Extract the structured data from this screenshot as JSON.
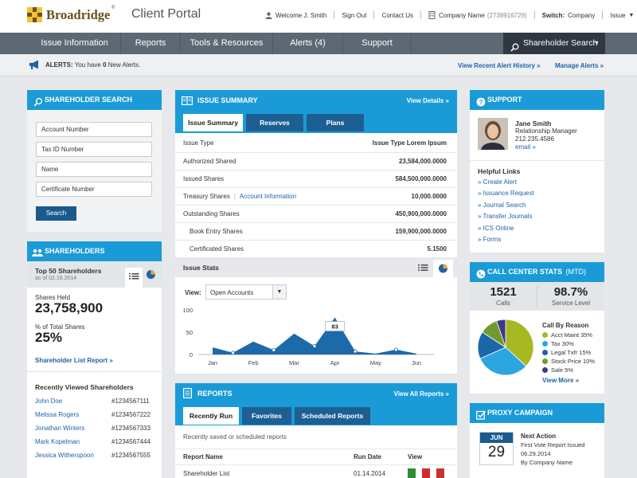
{
  "header": {
    "brand": "Broadridge",
    "trademark": "®",
    "portal_title": "Client Portal",
    "welcome_text": "Welcome J. Smith",
    "signout": "Sign Out",
    "contact": "Contact Us",
    "company": "Company Name",
    "company_id": "(2738916729)",
    "switch_label": "Switch:",
    "switch_company": "Company",
    "switch_issue": "Issue"
  },
  "nav": {
    "items": [
      "Issue Information",
      "Reports",
      "Tools & Resources",
      "Alerts (4)",
      "Support"
    ],
    "search_label": "Shareholder Search"
  },
  "alerts": {
    "prefix": "ALERTS:",
    "text_a": "You have",
    "count": "0",
    "text_b": "New Alerts.",
    "history_link": "View Recent Alert History »",
    "manage_link": "Manage Alerts »"
  },
  "shareholder_search": {
    "title": "SHAREHOLDER SEARCH",
    "fields": [
      "Account Number",
      "Tax ID Number",
      "Name",
      "Certificate Number"
    ],
    "button": "Search"
  },
  "shareholders": {
    "title": "SHAREHOLDERS",
    "top50_title": "Top 50 Shareholders",
    "top50_date": "as of 02.16.2014",
    "shares_held_label": "Shares Held",
    "shares_held": "23,758,900",
    "pct_label": "% of Total Shares",
    "pct": "25%",
    "report_link": "Shareholder List Report »",
    "recent_title": "Recently Viewed Shareholders",
    "recent": [
      {
        "name": "John Doe",
        "id": "#1234567111"
      },
      {
        "name": "Melissa Rogers",
        "id": "#1234567222"
      },
      {
        "name": "Jonathan Winters",
        "id": "#1234567333"
      },
      {
        "name": "Mark Kopelman",
        "id": "#1234567444"
      },
      {
        "name": "Jessica Witherspoon",
        "id": "#1234567555"
      }
    ]
  },
  "issue_summary": {
    "title": "ISSUE SUMMARY",
    "view_details": "View Details »",
    "tabs": [
      "Issue Summary",
      "Reserves",
      "Plans"
    ],
    "rows": [
      {
        "label": "Issue Type",
        "value": "Issue Type Lorem Ipsum"
      },
      {
        "label": "Authorized Shared",
        "value": "23,584,000.0000"
      },
      {
        "label": "Issued Shares",
        "value": "584,500,000.0000"
      },
      {
        "label": "Treasury Shares",
        "link": "Account Information",
        "value": "10,000.0000"
      },
      {
        "label": "Outstanding Shares",
        "value": "450,900,000.0000"
      },
      {
        "label": "Book Entry Shares",
        "value": "159,900,000.0000"
      },
      {
        "label": "Certificated Shares",
        "value": "5.1500"
      }
    ],
    "stats_title": "Issue Stats",
    "view_label": "View:",
    "view_selected": "Open Accounts"
  },
  "chart_data": {
    "type": "area",
    "categories": [
      "Jan",
      "Feb",
      "Mar",
      "Apr",
      "May",
      "Jun"
    ],
    "x": [
      0,
      0.5,
      1,
      1.5,
      2,
      2.5,
      3,
      3.5,
      4,
      4.5,
      5
    ],
    "values": [
      16,
      4,
      29,
      10,
      47,
      19,
      83,
      7,
      2,
      11,
      2
    ],
    "highlight_index": 6,
    "highlight_label": "83",
    "y_ticks": [
      0,
      50,
      100
    ],
    "ylim": [
      0,
      100
    ]
  },
  "reports": {
    "title": "REPORTS",
    "view_all": "View All Reports »",
    "tabs": [
      "Recently Run",
      "Favorites",
      "Scheduled Reports"
    ],
    "subtitle": "Recently saved or scheduled reports",
    "columns": [
      "Report Name",
      "Run Date",
      "View"
    ],
    "rows": [
      {
        "name": "Shareholder List",
        "date": "01.14.2014"
      }
    ]
  },
  "support": {
    "title": "SUPPORT",
    "name": "Jane Smith",
    "role": "Relationship Manager",
    "phone": "212.235.4586",
    "email": "email »",
    "links_title": "Helpful Links",
    "links": [
      "» Create Alert",
      "» Issuance Request",
      "» Journal Search",
      "» Transfer Journals",
      "» ICS Online",
      "» Forms"
    ]
  },
  "call_center": {
    "title": "CALL CENTER STATS",
    "title_suffix": "(MTD)",
    "calls": "1521",
    "calls_label": "Calls",
    "service": "98.7%",
    "service_label": "Service Level",
    "reason_title": "Call By Reason",
    "reasons": [
      {
        "label": "Acct Maint 35%",
        "pct": 35,
        "color": "#a6b822"
      },
      {
        "label": "Tax 30%",
        "pct": 30,
        "color": "#2ca6e0"
      },
      {
        "label": "Legal Txfr 15%",
        "pct": 15,
        "color": "#1a67a8"
      },
      {
        "label": "Stock Price 10%",
        "pct": 10,
        "color": "#6f9a2e"
      },
      {
        "label": "Sale 5%",
        "pct": 5,
        "color": "#3d3a86"
      }
    ],
    "view_more": "View More »"
  },
  "proxy": {
    "title": "PROXY CAMPAIGN",
    "month": "JUN",
    "day": "29",
    "next_action_label": "Next Action",
    "next_action": "First Vote Report Issued",
    "next_date": "06.29.2014",
    "by": "By Company Name"
  },
  "colors": {
    "accent": "#1a9bd7",
    "nav": "#5c6874",
    "dark_tab": "#1d5f93",
    "chart_area": "#1d6aab"
  }
}
